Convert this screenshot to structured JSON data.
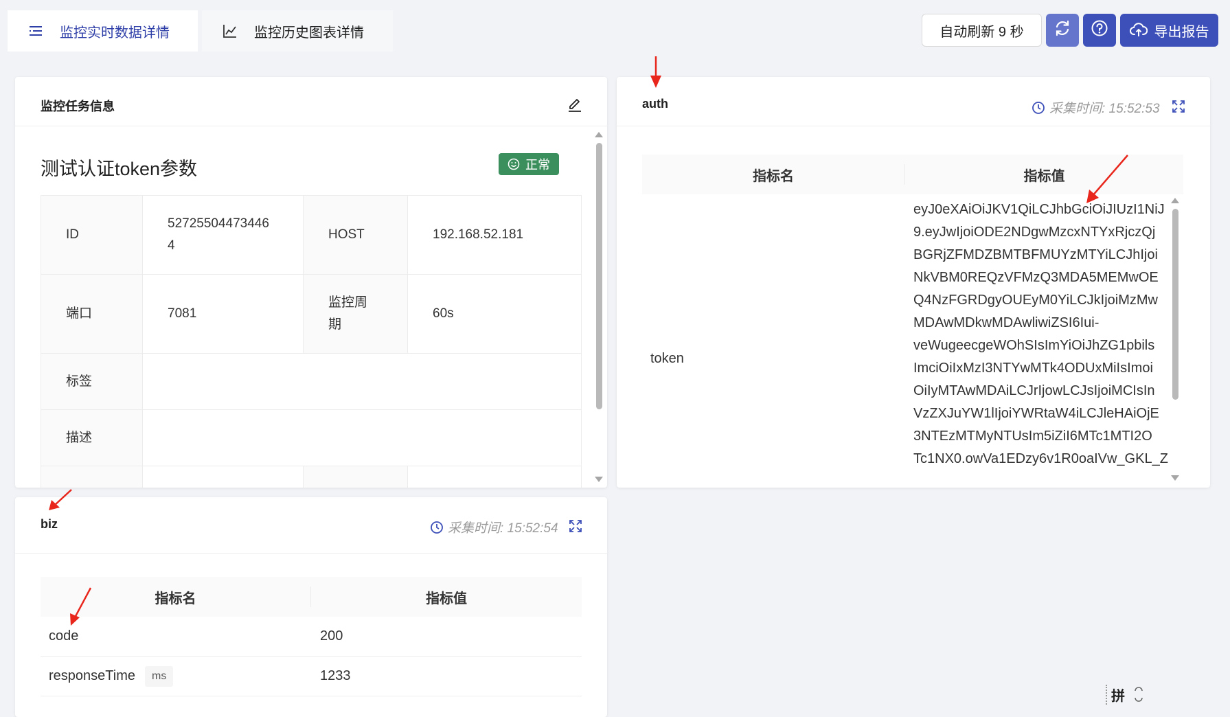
{
  "tabs": {
    "realtime": "监控实时数据详情",
    "history": "监控历史图表详情"
  },
  "toolbar": {
    "auto_refresh": "自动刷新 9 秒",
    "export": "导出报告"
  },
  "task_card": {
    "title": "监控任务信息",
    "monitor_name": "测试认证token参数",
    "status": "正常",
    "labels": {
      "id": "ID",
      "host": "HOST",
      "port": "端口",
      "period": "监控周期",
      "tags": "标签",
      "desc": "描述"
    },
    "values": {
      "id_line1": "52725504473446",
      "id_line2": "4",
      "host": "192.168.52.181",
      "port": "7081",
      "period_line1": "监控周",
      "period_line2": "期",
      "period": "60s"
    }
  },
  "auth_card": {
    "title": "auth",
    "collect_time": "采集时间: 15:52:53",
    "col_name": "指标名",
    "col_value": "指标值",
    "metric_name": "token",
    "token_lines": [
      "eyJ0eXAiOiJKV1QiLCJhbGciOiJIUzI1NiJ",
      "9.eyJwIjoiODE2NDgwMzcxNTYxRjczQj",
      "BGRjZFMDZBMTBFMUYzMTYiLCJhIjoi",
      "NkVBM0REQzVFMzQ3MDA5MEMwOE",
      "Q4NzFGRDgyOUEyM0YiLCJkIjoiMzMw",
      "MDAwMDkwMDAwliwiZSI6Iui-",
      "veWugeecgeWOhSIsImYiOiJhZG1pbils",
      "ImciOiIxMzI3NTYwMTk4ODUxMiIsImoi",
      "OiIyMTAwMDAiLCJrIjowLCJsIjoiMCIsIn",
      "VzZXJuYW1lIjoiYWRtaW4iLCJleHAiOjE",
      "3NTEzMTMyNTUsIm5iZiI6MTc1MTI2O",
      "Tc1NX0.owVa1EDzy6v1R0oaIVw_GKL_Z"
    ]
  },
  "biz_card": {
    "title": "biz",
    "collect_time": "采集时间: 15:52:54",
    "col_name": "指标名",
    "col_value": "指标值",
    "rows": [
      {
        "name": "code",
        "unit": "",
        "value": "200"
      },
      {
        "name": "responseTime",
        "unit": "ms",
        "value": "1233"
      }
    ]
  },
  "ime": {
    "label": "拼"
  },
  "colors": {
    "accent": "#3d4fb8",
    "status_green": "#3a8f5c",
    "arrow_red": "#e8261c"
  }
}
